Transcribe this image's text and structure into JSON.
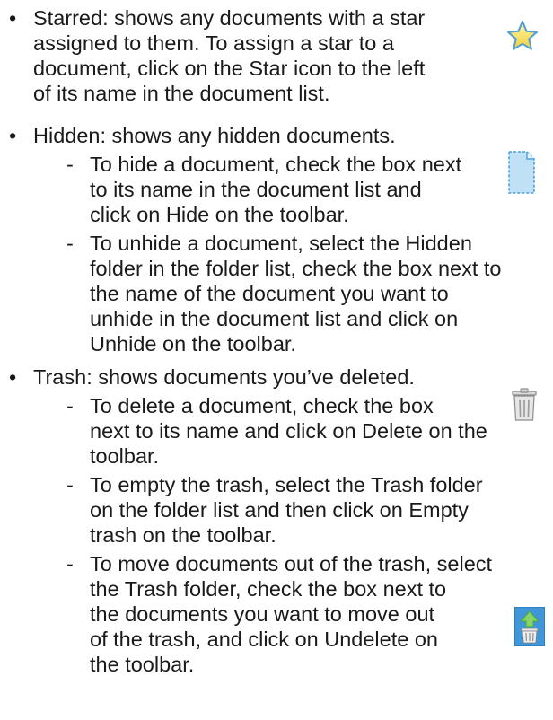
{
  "items": [
    {
      "bullet": "•",
      "lines": [
        "Starred: shows any documents with a star",
        "assigned to them. To assign a star to a",
        "document, click on the Star icon to the left",
        "of its name in the document list."
      ],
      "icon": "star-icon"
    },
    {
      "bullet": "•",
      "lines": [
        "Hidden: shows any hidden documents."
      ],
      "icon": "hidden-document-icon",
      "subitems": [
        {
          "dash": "-",
          "lines": [
            "To hide a document, check the box next",
            "to its name in the document list and",
            "click on Hide on the toolbar."
          ]
        },
        {
          "dash": "-",
          "lines": [
            "To unhide a document, select the Hidden",
            "folder in the folder list, check the box next to",
            "the name of the document you want to",
            "unhide in the document list and click on",
            "Unhide on the toolbar."
          ]
        }
      ]
    },
    {
      "bullet": "•",
      "lines": [
        "Trash: shows documents you’ve deleted."
      ],
      "icon": "trash-icon",
      "subitems": [
        {
          "dash": "-",
          "lines": [
            "To delete a document, check the box",
            "next to its name and click on Delete on the",
            "toolbar."
          ]
        },
        {
          "dash": "-",
          "lines": [
            "To empty the trash, select the Trash folder",
            "on the folder list and then click on Empty",
            "trash on the toolbar."
          ]
        },
        {
          "dash": "-",
          "lines": [
            "To move documents out of the trash, select",
            "the Trash folder, check the box next to",
            "the documents you want to move out",
            "of the trash, and click on Undelete on",
            "the toolbar."
          ],
          "icon": "undelete-icon"
        }
      ]
    }
  ]
}
